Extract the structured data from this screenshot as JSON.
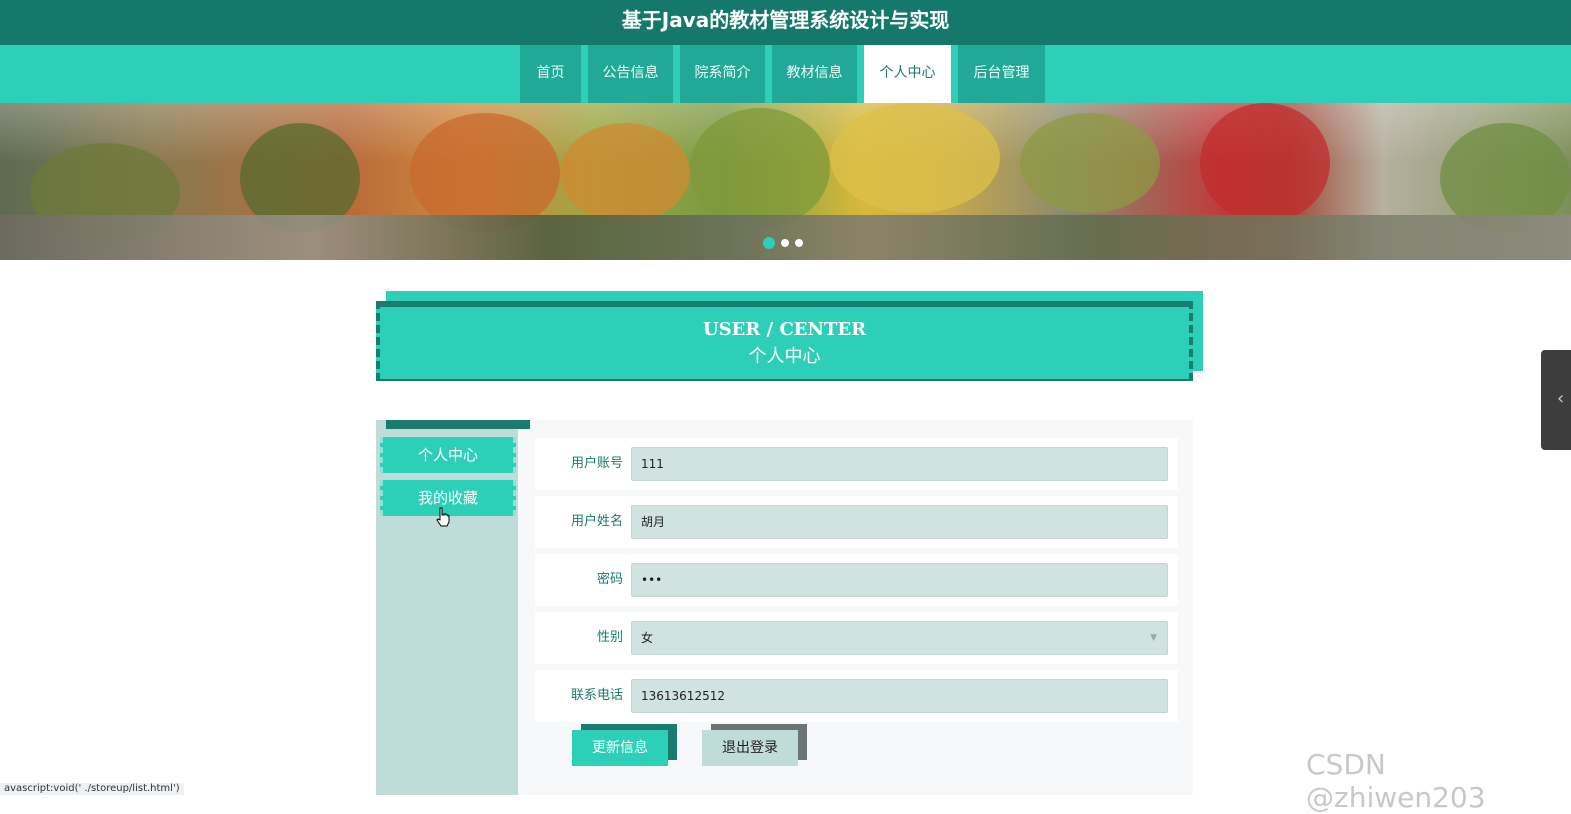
{
  "header": {
    "title": "基于Java的教材管理系统设计与实现"
  },
  "nav": {
    "items": [
      {
        "label": "首页"
      },
      {
        "label": "公告信息"
      },
      {
        "label": "院系简介"
      },
      {
        "label": "教材信息"
      },
      {
        "label": "个人中心",
        "active": true
      },
      {
        "label": "后台管理"
      }
    ]
  },
  "carousel": {
    "slides": 3,
    "active_index": 0
  },
  "section": {
    "title_en": "USER / CENTER",
    "title_cn": "个人中心"
  },
  "sidebar": {
    "items": [
      {
        "label": "个人中心"
      },
      {
        "label": "我的收藏"
      }
    ]
  },
  "form": {
    "account": {
      "label": "用户账号",
      "value": "111"
    },
    "name": {
      "label": "用户姓名",
      "value": "胡月"
    },
    "password": {
      "label": "密码",
      "value": "•••"
    },
    "gender": {
      "label": "性别",
      "value": "女"
    },
    "phone": {
      "label": "联系电话",
      "value": "13613612512"
    }
  },
  "buttons": {
    "update": "更新信息",
    "logout": "退出登录"
  },
  "status_bar": {
    "url": "avascript:void(' ./storeup/list.html')"
  },
  "watermark": "CSDN @zhiwen203",
  "colors": {
    "primary": "#2ecfb8",
    "dark": "#14786a",
    "field": "#d1e3e0",
    "sidebar": "#c0dcd8"
  },
  "icons": {
    "side_tab": "chevron-left-icon",
    "select": "chevron-down-icon",
    "pointer": "hand-cursor-icon"
  }
}
